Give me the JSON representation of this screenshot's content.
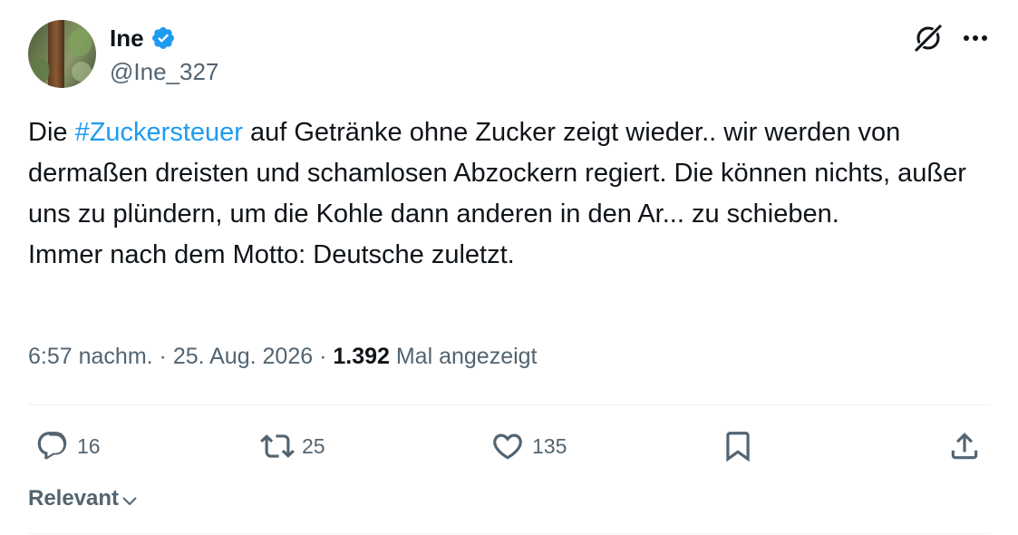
{
  "author": {
    "display_name": "Ine",
    "handle": "@Ine_327",
    "verified": true,
    "verified_color": "#1d9bf0"
  },
  "header_icons": [
    "grok-icon",
    "more-icon"
  ],
  "tweet": {
    "text_before_hashtag": "Die ",
    "hashtag": "#Zuckersteuer",
    "text_after_hashtag": " auf Getränke ohne Zucker zeigt wieder.. wir werden von dermaßen dreisten und schamlosen Abzockern regiert. Die können nichts, außer uns zu plündern, um die Kohle dann anderen in den Ar... zu schieben.\nImmer nach dem Motto: Deutsche zuletzt.",
    "hashtag_color": "#1d9bf0"
  },
  "meta": {
    "time": "6:57 nachm.",
    "separator": " · ",
    "date": "25. Aug. 2026",
    "views_count": "1.392",
    "views_label": " Mal angezeigt"
  },
  "actions": {
    "replies": "16",
    "reposts": "25",
    "likes": "135"
  },
  "sort": {
    "label": "Relevant"
  }
}
